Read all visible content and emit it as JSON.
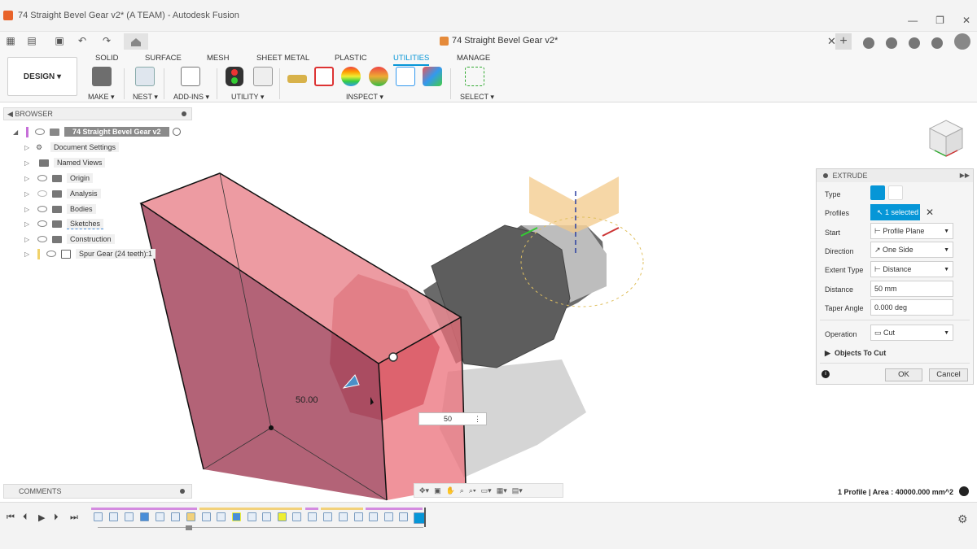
{
  "window": {
    "title": "74 Straight Bevel Gear v2* (A TEAM) - Autodesk Fusion",
    "controls": [
      "—",
      "❐",
      "✕"
    ]
  },
  "doc_tab": {
    "label": "74 Straight Bevel Gear v2*"
  },
  "ribbon": {
    "workspace": "DESIGN",
    "tabs": [
      "SOLID",
      "SURFACE",
      "MESH",
      "SHEET METAL",
      "PLASTIC",
      "UTILITIES",
      "MANAGE"
    ],
    "active_tab": "UTILITIES",
    "groups": [
      "MAKE",
      "NEST",
      "ADD-INS",
      "UTILITY",
      "INSPECT",
      "SELECT"
    ]
  },
  "browser": {
    "header": "BROWSER",
    "root": "74 Straight Bevel Gear v2",
    "items": [
      {
        "label": "Document Settings",
        "icon": "gear-icon"
      },
      {
        "label": "Named Views",
        "icon": "folder-icon"
      },
      {
        "label": "Origin",
        "icon": "folder-icon"
      },
      {
        "label": "Analysis",
        "icon": "folder-icon"
      },
      {
        "label": "Bodies",
        "icon": "folder-icon"
      },
      {
        "label": "Sketches",
        "icon": "folder-icon"
      },
      {
        "label": "Construction",
        "icon": "folder-icon"
      },
      {
        "label": "Spur Gear (24 teeth):1",
        "icon": "component-icon"
      }
    ]
  },
  "comments": {
    "label": "COMMENTS"
  },
  "extrude": {
    "title": "EXTRUDE",
    "labels": {
      "type": "Type",
      "profiles": "Profiles",
      "start": "Start",
      "direction": "Direction",
      "extent_type": "Extent Type",
      "distance": "Distance",
      "taper_angle": "Taper Angle",
      "operation": "Operation",
      "objects_to_cut": "Objects To Cut"
    },
    "values": {
      "profiles": "1 selected",
      "start": "Profile Plane",
      "direction": "One Side",
      "extent_type": "Distance",
      "distance": "50 mm",
      "taper_angle": "0.000 deg",
      "operation": "Cut"
    },
    "ok": "OK",
    "cancel": "Cancel"
  },
  "viewport": {
    "dimension_label": "50.00",
    "dimension_input": "50"
  },
  "status": {
    "text": "1 Profile | Area : 40000.000 mm^2"
  },
  "colors": {
    "accent": "#0696d7",
    "cut_body": "#e8707a",
    "gear": "#6b6b6b"
  }
}
